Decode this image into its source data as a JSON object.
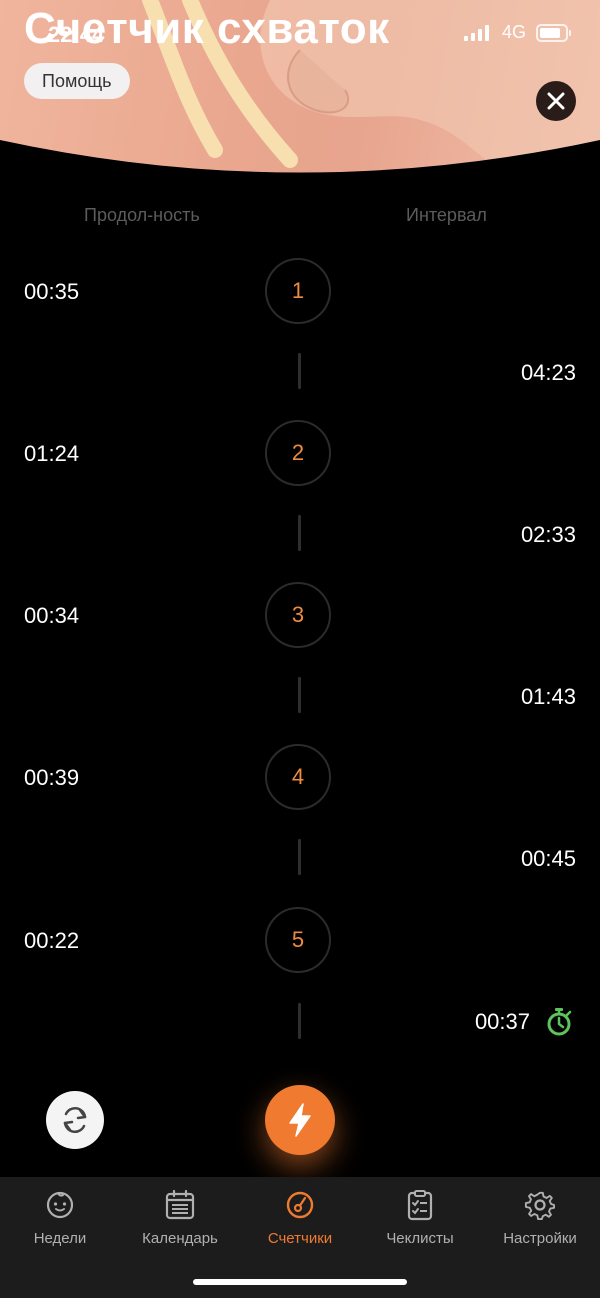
{
  "status": {
    "time": "22:44",
    "network": "4G"
  },
  "header": {
    "title": "Счетчик схваток",
    "help_label": "Помощь"
  },
  "columns": {
    "duration": "Продол-ность",
    "interval": "Интервал"
  },
  "contractions": [
    {
      "num": "1",
      "duration": "00:35",
      "interval": "04:23"
    },
    {
      "num": "2",
      "duration": "01:24",
      "interval": "02:33"
    },
    {
      "num": "3",
      "duration": "00:34",
      "interval": "01:43"
    },
    {
      "num": "4",
      "duration": "00:39",
      "interval": "00:45"
    },
    {
      "num": "5",
      "duration": "00:22",
      "interval": "00:37"
    }
  ],
  "tabs": [
    {
      "label": "Недели",
      "icon": "baby-face-icon"
    },
    {
      "label": "Календарь",
      "icon": "calendar-icon"
    },
    {
      "label": "Счетчики",
      "icon": "counter-icon",
      "active": true
    },
    {
      "label": "Чеклисты",
      "icon": "checklist-icon"
    },
    {
      "label": "Настройки",
      "icon": "gear-icon"
    }
  ],
  "colors": {
    "accent": "#ef7a30",
    "timer": "#5cc45a",
    "background": "#000000",
    "tabbar": "#1c1c1c"
  }
}
